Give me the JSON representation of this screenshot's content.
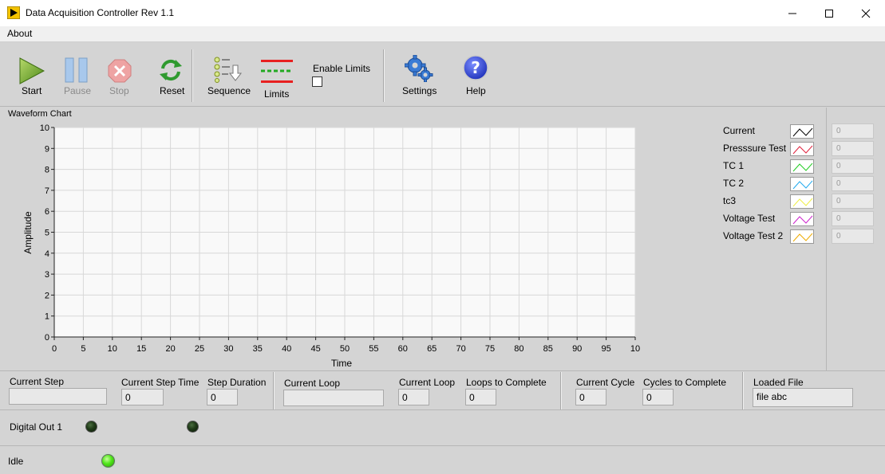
{
  "window": {
    "title": "Data Acquisition Controller Rev 1.1"
  },
  "menu": {
    "items": [
      "About"
    ]
  },
  "toolbar": {
    "start_label": "Start",
    "pause_label": "Pause",
    "stop_label": "Stop",
    "reset_label": "Reset",
    "sequence_label": "Sequence",
    "limits_label": "Limits",
    "enable_limits_label": "Enable Limits",
    "enable_limits_checked": false,
    "settings_label": "Settings",
    "help_label": "Help",
    "icons": [
      "play-icon",
      "pause-icon",
      "stop-icon",
      "reset-icon",
      "sequence-icon",
      "limits-icon",
      "settings-icon",
      "help-icon"
    ]
  },
  "chart": {
    "title": "Waveform Chart"
  },
  "chart_data": {
    "type": "line",
    "title": "Waveform Chart",
    "xlabel": "Time",
    "ylabel": "Amplitude",
    "xlim": [
      0,
      100
    ],
    "ylim": [
      0,
      10
    ],
    "x_ticks": [
      "0",
      "5",
      "10",
      "15",
      "20",
      "25",
      "30",
      "35",
      "40",
      "45",
      "50",
      "55",
      "60",
      "65",
      "70",
      "75",
      "80",
      "85",
      "90",
      "95",
      "10"
    ],
    "y_ticks": [
      "0",
      "1",
      "2",
      "3",
      "4",
      "5",
      "6",
      "7",
      "8",
      "9",
      "10"
    ],
    "grid": true,
    "legend_position": "right",
    "series": [
      {
        "name": "Current",
        "color": "#000000",
        "values": []
      },
      {
        "name": "Presssure Test",
        "color": "#e0203c",
        "values": []
      },
      {
        "name": "TC 1",
        "color": "#22cc22",
        "values": []
      },
      {
        "name": "TC 2",
        "color": "#22aaee",
        "values": []
      },
      {
        "name": "tc3",
        "color": "#eeee44",
        "values": []
      },
      {
        "name": "Voltage Test",
        "color": "#cc22cc",
        "values": []
      },
      {
        "name": "Voltage Test 2",
        "color": "#eeaa00",
        "values": []
      }
    ]
  },
  "legend_values": [
    "0",
    "0",
    "0",
    "0",
    "0",
    "0",
    "0"
  ],
  "status": {
    "current_step_label": "Current Step",
    "current_step_value": "",
    "current_step_time_label": "Current Step Time",
    "current_step_time_value": "0",
    "step_duration_label": "Step Duration",
    "step_duration_value": "0",
    "current_loop_label": "Current Loop",
    "current_loop_text": "",
    "current_loop_num_label": "Current Loop",
    "current_loop_num_value": "0",
    "loops_to_complete_label": "Loops to Complete",
    "loops_to_complete_value": "0",
    "current_cycle_label": "Current Cycle",
    "current_cycle_value": "0",
    "cycles_to_complete_label": "Cycles to Complete",
    "cycles_to_complete_value": "0",
    "loaded_file_label": "Loaded File",
    "loaded_file_value": "file abc"
  },
  "digital": {
    "label": "Digital Out 1",
    "leds": [
      false,
      false
    ]
  },
  "state": {
    "label": "Idle",
    "led_on": true
  }
}
